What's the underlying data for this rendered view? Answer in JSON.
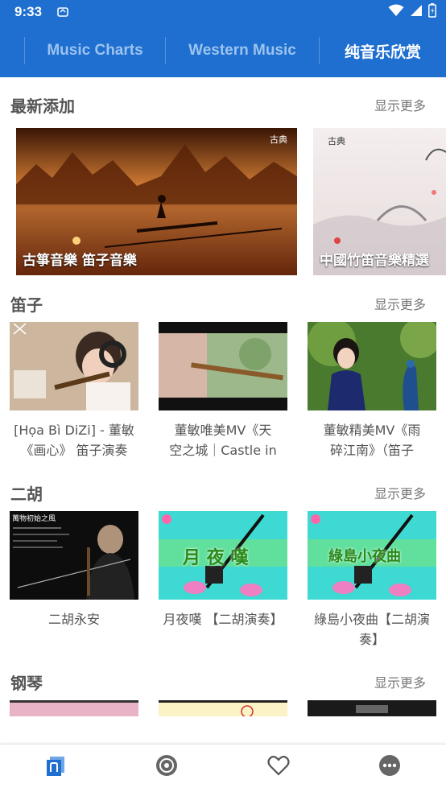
{
  "status": {
    "time": "9:33"
  },
  "tabs": [
    {
      "label": "Music Charts",
      "active": false
    },
    {
      "label": "Western Music",
      "active": false
    },
    {
      "label": "纯音乐欣赏",
      "active": true
    }
  ],
  "sections": {
    "latest": {
      "title": "最新添加",
      "more": "显示更多",
      "items": [
        {
          "caption": "古箏音樂 笛子音樂"
        },
        {
          "caption": "中國竹笛音樂精選"
        }
      ]
    },
    "dizi": {
      "title": "笛子",
      "more": "显示更多",
      "items": [
        {
          "title_l1": "[Họa Bì DiZi] - 董敏",
          "title_l2": "《画心》 笛子演奏"
        },
        {
          "title_l1": "董敏唯美MV《天",
          "title_l2": "空之城｜Castle in"
        },
        {
          "title_l1": "董敏精美MV《雨",
          "title_l2": "碎江南》（笛子"
        }
      ]
    },
    "erhu": {
      "title": "二胡",
      "more": "显示更多",
      "items": [
        {
          "title_l1": "二胡永安",
          "title_l2": ""
        },
        {
          "title_l1": "月夜嘆 【二胡演奏】",
          "title_l2": ""
        },
        {
          "title_l1": "綠島小夜曲【二胡演",
          "title_l2": "奏】"
        }
      ],
      "thumb_texts": [
        "萬物初始之風",
        "月 夜 嘆",
        "綠島小夜曲"
      ]
    },
    "piano": {
      "title": "钢琴",
      "more": "显示更多"
    }
  },
  "featured_badges": [
    "古典",
    "古典"
  ],
  "bottom_nav": [
    {
      "icon": "library-icon",
      "active": true
    },
    {
      "icon": "disc-icon",
      "active": false
    },
    {
      "icon": "heart-icon",
      "active": false
    },
    {
      "icon": "more-icon",
      "active": false
    }
  ],
  "colors": {
    "primary": "#1e6fcf",
    "tab_inactive": "#9cc3ef"
  }
}
